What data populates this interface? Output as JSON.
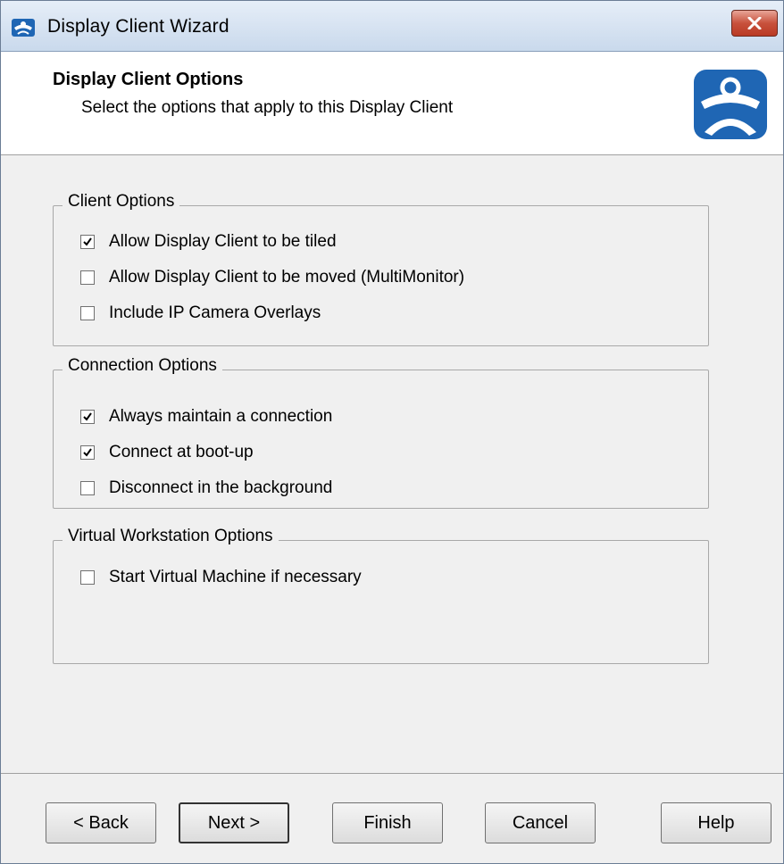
{
  "window": {
    "title": "Display Client Wizard"
  },
  "header": {
    "title": "Display Client Options",
    "subtitle": "Select the options that apply to this Display Client"
  },
  "groups": {
    "client": {
      "label": "Client Options",
      "options": [
        {
          "label": "Allow Display Client to be tiled",
          "checked": true
        },
        {
          "label": "Allow Display Client to be moved (MultiMonitor)",
          "checked": false
        },
        {
          "label": "Include IP Camera Overlays",
          "checked": false
        }
      ]
    },
    "connection": {
      "label": "Connection Options",
      "options": [
        {
          "label": "Always maintain a connection",
          "checked": true
        },
        {
          "label": "Connect at boot-up",
          "checked": true
        },
        {
          "label": "Disconnect in the background",
          "checked": false
        }
      ]
    },
    "virtual": {
      "label": "Virtual Workstation Options",
      "options": [
        {
          "label": "Start Virtual Machine if necessary",
          "checked": false
        }
      ]
    }
  },
  "buttons": {
    "back": "< Back",
    "next": "Next >",
    "finish": "Finish",
    "cancel": "Cancel",
    "help": "Help"
  },
  "colors": {
    "title_gradient_top": "#e6eef8",
    "close_red": "#c8513c",
    "logo_blue": "#1f66b4",
    "dialog_bg": "#f0f0f0"
  },
  "icons": {
    "app": "thinmanager-icon",
    "close": "close-icon",
    "logo": "thinmanager-logo"
  }
}
